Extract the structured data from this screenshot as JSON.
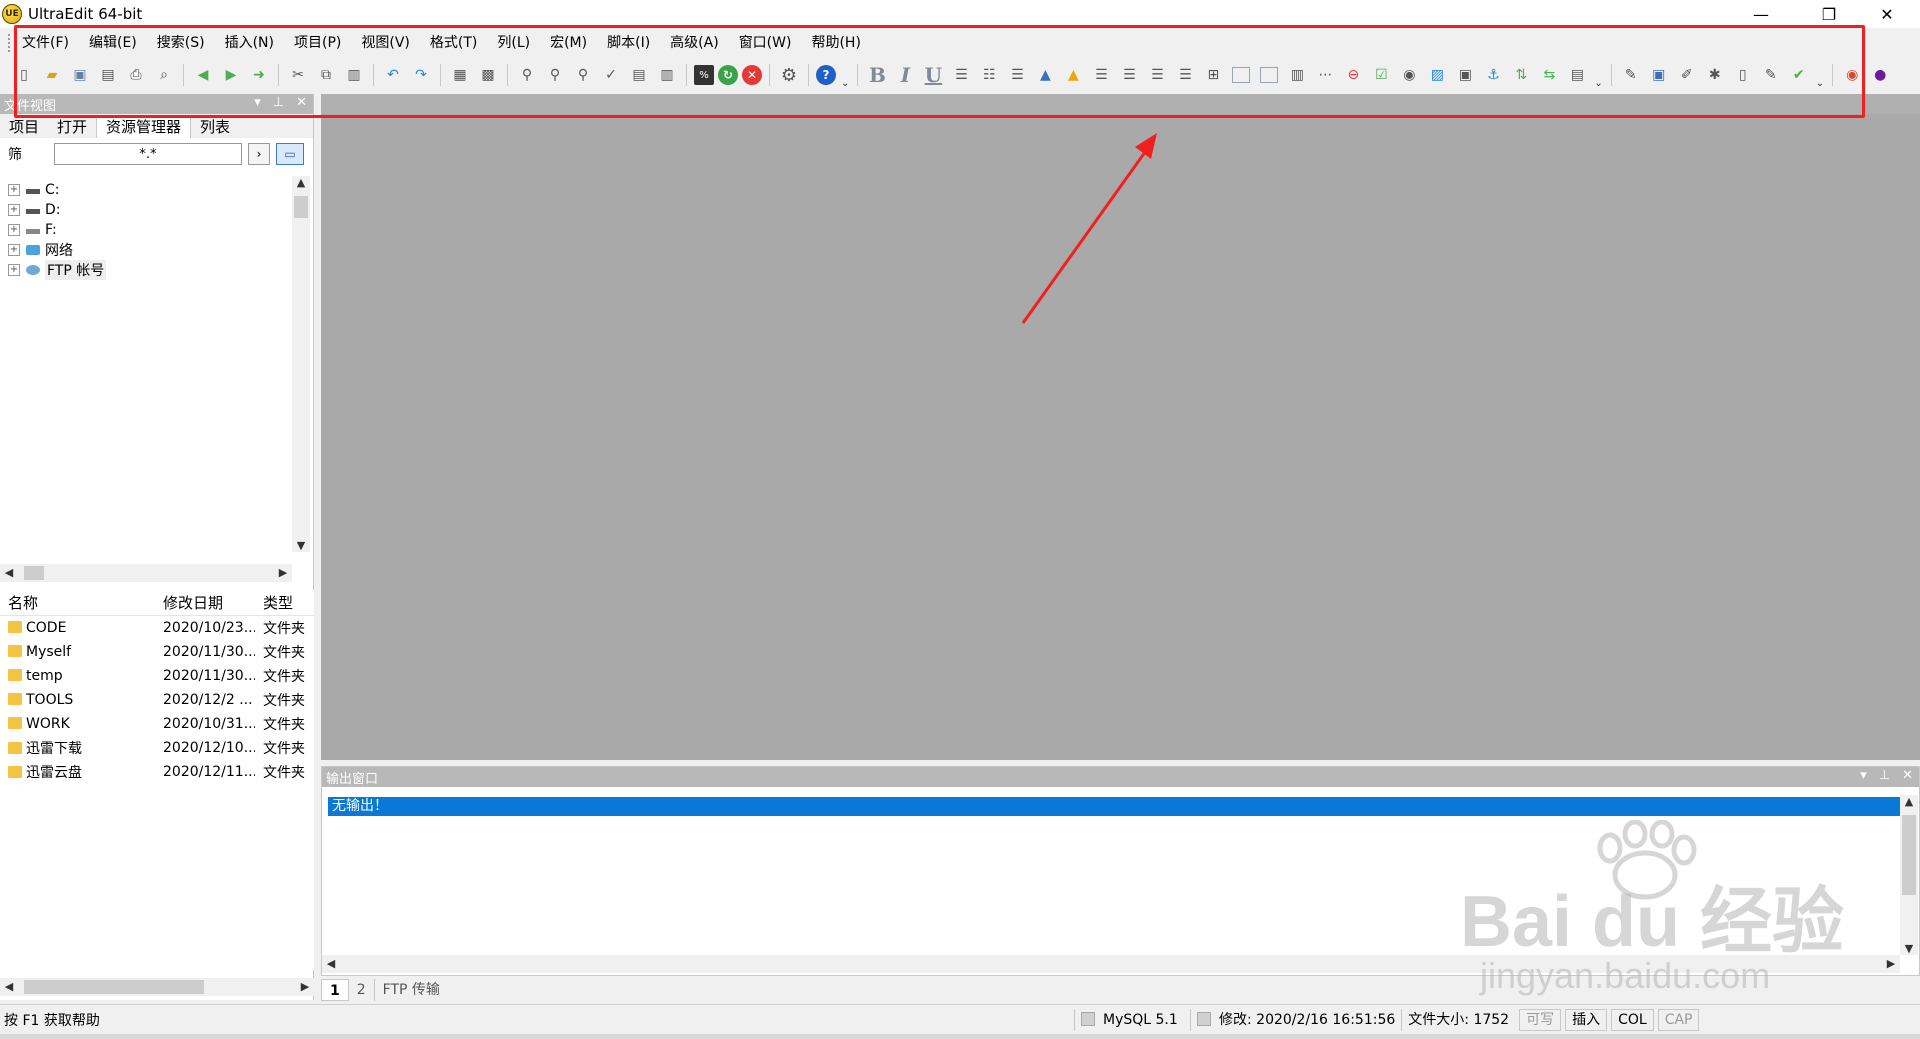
{
  "window": {
    "title": "UltraEdit 64-bit",
    "logo_text": "UE",
    "minimize_glyph": "—",
    "restore_glyph": "❐",
    "close_glyph": "✕"
  },
  "menu": [
    "文件(F)",
    "编辑(E)",
    "搜索(S)",
    "插入(N)",
    "项目(P)",
    "视图(V)",
    "格式(T)",
    "列(L)",
    "宏(M)",
    "脚本(I)",
    "高级(A)",
    "窗口(W)",
    "帮助(H)"
  ],
  "toolbar": {
    "bold": "B",
    "italic": "I",
    "underline": "U",
    "more": "⌄",
    "dark_icon_label": "%"
  },
  "file_view": {
    "header": "文件视图",
    "tabs": [
      "项目",
      "打开",
      "资源管理器",
      "列表"
    ],
    "active_tab": 2,
    "filter_label": "筛",
    "filter_value": "*.*",
    "tree": [
      {
        "label": "C:",
        "icon": "drive-icon"
      },
      {
        "label": "D:",
        "icon": "drive-icon"
      },
      {
        "label": "F:",
        "icon": "network-drive-icon"
      },
      {
        "label": "网络",
        "icon": "network-icon"
      },
      {
        "label": "FTP 帐号",
        "icon": "ftp-account-icon"
      }
    ],
    "columns": [
      "名称",
      "修改日期",
      "类型"
    ],
    "files": [
      {
        "name": "CODE",
        "date": "2020/10/23...",
        "type": "文件夹"
      },
      {
        "name": "Myself",
        "date": "2020/11/30...",
        "type": "文件夹"
      },
      {
        "name": "temp",
        "date": "2020/11/30...",
        "type": "文件夹"
      },
      {
        "name": "TOOLS",
        "date": "2020/12/2 ...",
        "type": "文件夹"
      },
      {
        "name": "WORK",
        "date": "2020/10/31...",
        "type": "文件夹"
      },
      {
        "name": "迅雷下载",
        "date": "2020/12/10...",
        "type": "文件夹"
      },
      {
        "name": "迅雷云盘",
        "date": "2020/12/11...",
        "type": "文件夹"
      }
    ]
  },
  "output": {
    "header": "输出窗口",
    "line": "无输出！",
    "tabs": [
      "1",
      "2",
      "FTP 传输"
    ]
  },
  "status": {
    "help": "按 F1 获取帮助",
    "syntax": "MySQL 5.1",
    "modified": "修改:  2020/2/16 16:51:56",
    "filesize": "文件大小:  1752",
    "writable": "可写",
    "insert": "插入",
    "col": "COL",
    "cap": "CAP"
  },
  "watermark": {
    "brand": "Bai du 经验",
    "url": "jingyan.baidu.com"
  },
  "colors": {
    "highlight_box": "#f02020",
    "selection": "#0a78d6",
    "editor_bg": "#a9a9a9",
    "panel_header": "#b8b8b8"
  }
}
